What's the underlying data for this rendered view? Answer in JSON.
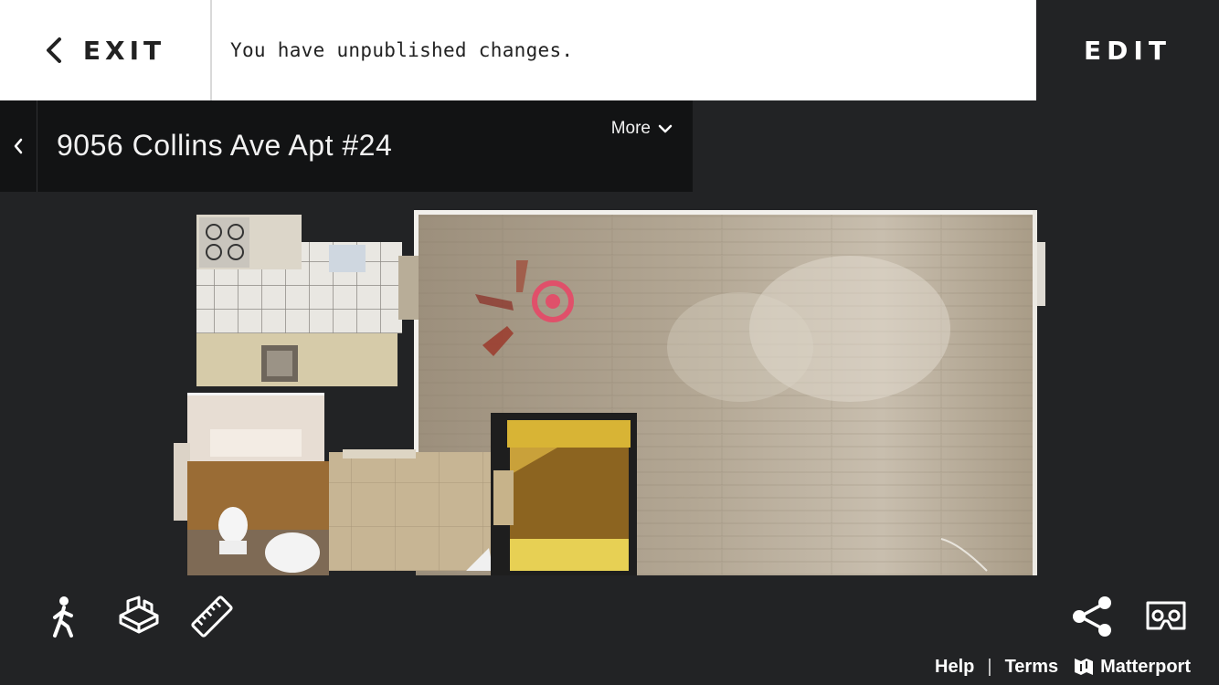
{
  "header": {
    "exit_label": "EXIT",
    "notice": "You have unpublished changes.",
    "edit_label": "EDIT"
  },
  "title_panel": {
    "address": "9056 Collins Ave Apt #24",
    "more_label": "More"
  },
  "toolbar": {
    "left_tools": [
      "walk-icon",
      "dollhouse-icon",
      "measure-icon"
    ],
    "right_tools": [
      "share-icon",
      "vr-headset-icon"
    ]
  },
  "footer": {
    "help": "Help",
    "separator": "|",
    "terms": "Terms",
    "brand": "Matterport"
  },
  "colors": {
    "background": "#222325",
    "topbar": "#ffffff",
    "title_panel": "#121314",
    "position_marker": "#e0506a",
    "floor_wood": "#a69985"
  }
}
